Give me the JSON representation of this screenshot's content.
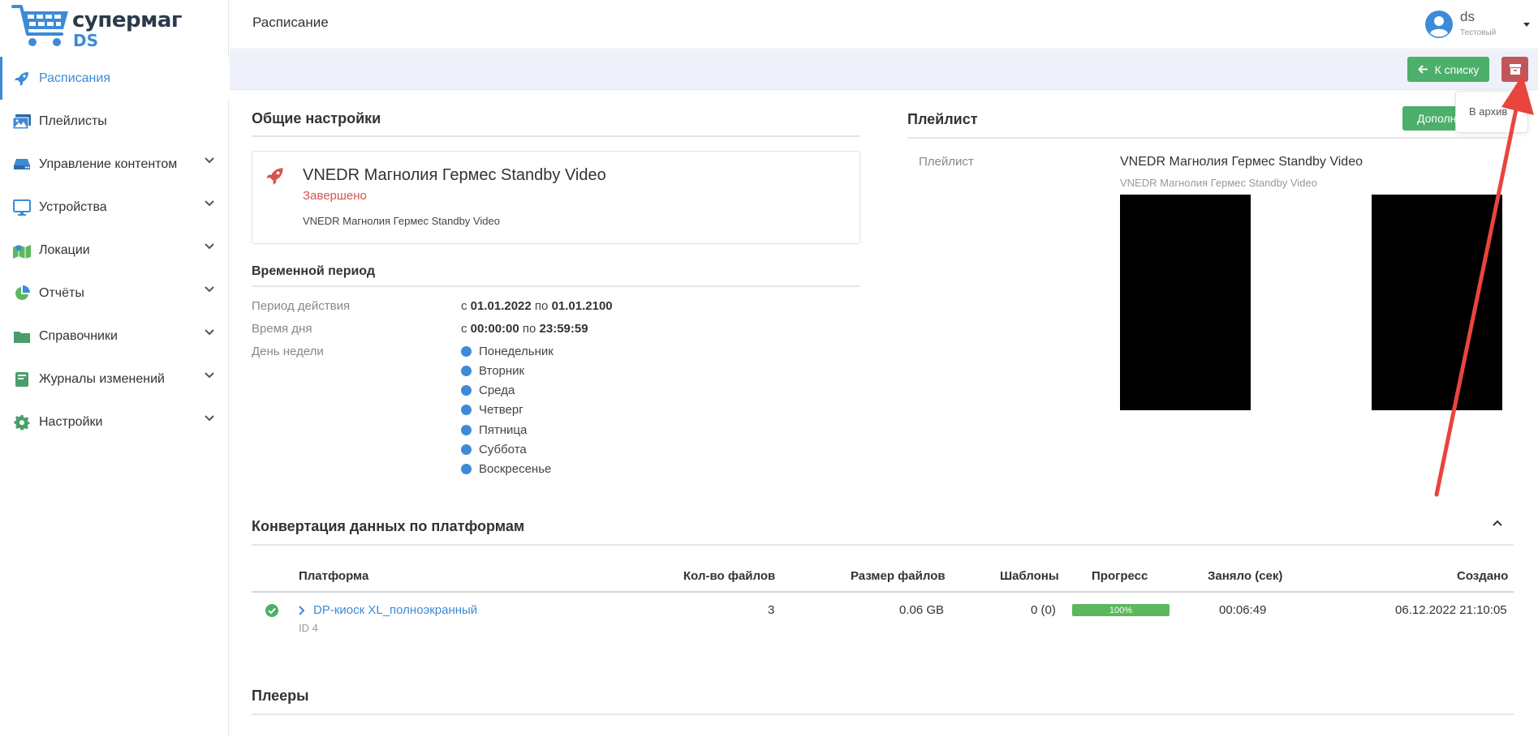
{
  "brand": {
    "line1": "супермаг",
    "line2": "DS"
  },
  "sidebar": {
    "items": [
      {
        "label": "Расписания",
        "icon": "rocket-icon",
        "active": true
      },
      {
        "label": "Плейлисты",
        "icon": "images-icon"
      },
      {
        "label": "Управление контентом",
        "icon": "hdd-icon",
        "expandable": true
      },
      {
        "label": "Устройства",
        "icon": "monitor-icon",
        "expandable": true
      },
      {
        "label": "Локации",
        "icon": "map-icon",
        "expandable": true
      },
      {
        "label": "Отчёты",
        "icon": "pie-chart-icon",
        "expandable": true
      },
      {
        "label": "Справочники",
        "icon": "folder-icon",
        "expandable": true
      },
      {
        "label": "Журналы изменений",
        "icon": "book-icon",
        "expandable": true
      },
      {
        "label": "Настройки",
        "icon": "gear-icon",
        "expandable": true
      }
    ]
  },
  "header": {
    "title": "Расписание",
    "user": {
      "name": "ds",
      "role": "Тестовый"
    }
  },
  "toolbar": {
    "back_label": "К списку",
    "archive_tooltip": "В архив"
  },
  "general": {
    "title": "Общие настройки",
    "schedule_name": "VNEDR Магнолия Гермес Standby Video",
    "status": "Завершено",
    "playlist_name": "VNEDR Магнолия Гермес Standby Video"
  },
  "period": {
    "title": "Временной период",
    "validity_label": "Период действия",
    "validity_from_prefix": "с",
    "validity_from": "01.01.2022",
    "validity_to_prefix": "по",
    "validity_to": "01.01.2100",
    "time_label": "Время дня",
    "time_from_prefix": "с",
    "time_from": "00:00:00",
    "time_to_prefix": "по",
    "time_to": "23:59:59",
    "weekday_label": "День недели",
    "days": [
      "Понедельник",
      "Вторник",
      "Среда",
      "Четверг",
      "Пятница",
      "Суббота",
      "Воскресенье"
    ]
  },
  "playlist": {
    "title": "Плейлист",
    "more_label": "Дополнительно",
    "field_label": "Плейлист",
    "name": "VNEDR Магнолия Гермес Standby Video",
    "sub": "VNEDR Магнолия Гермес Standby Video"
  },
  "conversion": {
    "title": "Конвертация данных по платформам",
    "columns": {
      "platform": "Платформа",
      "files": "Кол-во файлов",
      "size": "Размер файлов",
      "templates": "Шаблоны",
      "progress": "Прогресс",
      "duration": "Заняло (сек)",
      "created": "Создано"
    },
    "rows": [
      {
        "platform": "DP-киоск XL_полноэкранный",
        "id": "ID 4",
        "files": "3",
        "size": "0.06 GB",
        "templates": "0 (0)",
        "progress_label": "100%",
        "progress": 1.0,
        "duration": "00:06:49",
        "created": "06.12.2022 21:10:05"
      }
    ]
  },
  "players": {
    "title": "Плееры"
  },
  "colors": {
    "accent": "#3d8ad8",
    "success": "#4caf6a",
    "danger": "#c0565a",
    "status_done": "#d9534f"
  }
}
